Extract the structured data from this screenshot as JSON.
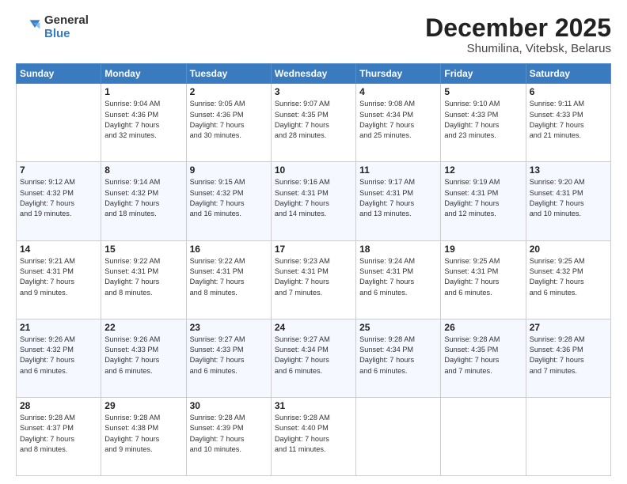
{
  "logo": {
    "general": "General",
    "blue": "Blue"
  },
  "header": {
    "month": "December 2025",
    "location": "Shumilina, Vitebsk, Belarus"
  },
  "days_of_week": [
    "Sunday",
    "Monday",
    "Tuesday",
    "Wednesday",
    "Thursday",
    "Friday",
    "Saturday"
  ],
  "weeks": [
    [
      {
        "day": "",
        "info": ""
      },
      {
        "day": "1",
        "info": "Sunrise: 9:04 AM\nSunset: 4:36 PM\nDaylight: 7 hours\nand 32 minutes."
      },
      {
        "day": "2",
        "info": "Sunrise: 9:05 AM\nSunset: 4:36 PM\nDaylight: 7 hours\nand 30 minutes."
      },
      {
        "day": "3",
        "info": "Sunrise: 9:07 AM\nSunset: 4:35 PM\nDaylight: 7 hours\nand 28 minutes."
      },
      {
        "day": "4",
        "info": "Sunrise: 9:08 AM\nSunset: 4:34 PM\nDaylight: 7 hours\nand 25 minutes."
      },
      {
        "day": "5",
        "info": "Sunrise: 9:10 AM\nSunset: 4:33 PM\nDaylight: 7 hours\nand 23 minutes."
      },
      {
        "day": "6",
        "info": "Sunrise: 9:11 AM\nSunset: 4:33 PM\nDaylight: 7 hours\nand 21 minutes."
      }
    ],
    [
      {
        "day": "7",
        "info": "Sunrise: 9:12 AM\nSunset: 4:32 PM\nDaylight: 7 hours\nand 19 minutes."
      },
      {
        "day": "8",
        "info": "Sunrise: 9:14 AM\nSunset: 4:32 PM\nDaylight: 7 hours\nand 18 minutes."
      },
      {
        "day": "9",
        "info": "Sunrise: 9:15 AM\nSunset: 4:32 PM\nDaylight: 7 hours\nand 16 minutes."
      },
      {
        "day": "10",
        "info": "Sunrise: 9:16 AM\nSunset: 4:31 PM\nDaylight: 7 hours\nand 14 minutes."
      },
      {
        "day": "11",
        "info": "Sunrise: 9:17 AM\nSunset: 4:31 PM\nDaylight: 7 hours\nand 13 minutes."
      },
      {
        "day": "12",
        "info": "Sunrise: 9:19 AM\nSunset: 4:31 PM\nDaylight: 7 hours\nand 12 minutes."
      },
      {
        "day": "13",
        "info": "Sunrise: 9:20 AM\nSunset: 4:31 PM\nDaylight: 7 hours\nand 10 minutes."
      }
    ],
    [
      {
        "day": "14",
        "info": "Sunrise: 9:21 AM\nSunset: 4:31 PM\nDaylight: 7 hours\nand 9 minutes."
      },
      {
        "day": "15",
        "info": "Sunrise: 9:22 AM\nSunset: 4:31 PM\nDaylight: 7 hours\nand 8 minutes."
      },
      {
        "day": "16",
        "info": "Sunrise: 9:22 AM\nSunset: 4:31 PM\nDaylight: 7 hours\nand 8 minutes."
      },
      {
        "day": "17",
        "info": "Sunrise: 9:23 AM\nSunset: 4:31 PM\nDaylight: 7 hours\nand 7 minutes."
      },
      {
        "day": "18",
        "info": "Sunrise: 9:24 AM\nSunset: 4:31 PM\nDaylight: 7 hours\nand 6 minutes."
      },
      {
        "day": "19",
        "info": "Sunrise: 9:25 AM\nSunset: 4:31 PM\nDaylight: 7 hours\nand 6 minutes."
      },
      {
        "day": "20",
        "info": "Sunrise: 9:25 AM\nSunset: 4:32 PM\nDaylight: 7 hours\nand 6 minutes."
      }
    ],
    [
      {
        "day": "21",
        "info": "Sunrise: 9:26 AM\nSunset: 4:32 PM\nDaylight: 7 hours\nand 6 minutes."
      },
      {
        "day": "22",
        "info": "Sunrise: 9:26 AM\nSunset: 4:33 PM\nDaylight: 7 hours\nand 6 minutes."
      },
      {
        "day": "23",
        "info": "Sunrise: 9:27 AM\nSunset: 4:33 PM\nDaylight: 7 hours\nand 6 minutes."
      },
      {
        "day": "24",
        "info": "Sunrise: 9:27 AM\nSunset: 4:34 PM\nDaylight: 7 hours\nand 6 minutes."
      },
      {
        "day": "25",
        "info": "Sunrise: 9:28 AM\nSunset: 4:34 PM\nDaylight: 7 hours\nand 6 minutes."
      },
      {
        "day": "26",
        "info": "Sunrise: 9:28 AM\nSunset: 4:35 PM\nDaylight: 7 hours\nand 7 minutes."
      },
      {
        "day": "27",
        "info": "Sunrise: 9:28 AM\nSunset: 4:36 PM\nDaylight: 7 hours\nand 7 minutes."
      }
    ],
    [
      {
        "day": "28",
        "info": "Sunrise: 9:28 AM\nSunset: 4:37 PM\nDaylight: 7 hours\nand 8 minutes."
      },
      {
        "day": "29",
        "info": "Sunrise: 9:28 AM\nSunset: 4:38 PM\nDaylight: 7 hours\nand 9 minutes."
      },
      {
        "day": "30",
        "info": "Sunrise: 9:28 AM\nSunset: 4:39 PM\nDaylight: 7 hours\nand 10 minutes."
      },
      {
        "day": "31",
        "info": "Sunrise: 9:28 AM\nSunset: 4:40 PM\nDaylight: 7 hours\nand 11 minutes."
      },
      {
        "day": "",
        "info": ""
      },
      {
        "day": "",
        "info": ""
      },
      {
        "day": "",
        "info": ""
      }
    ]
  ]
}
